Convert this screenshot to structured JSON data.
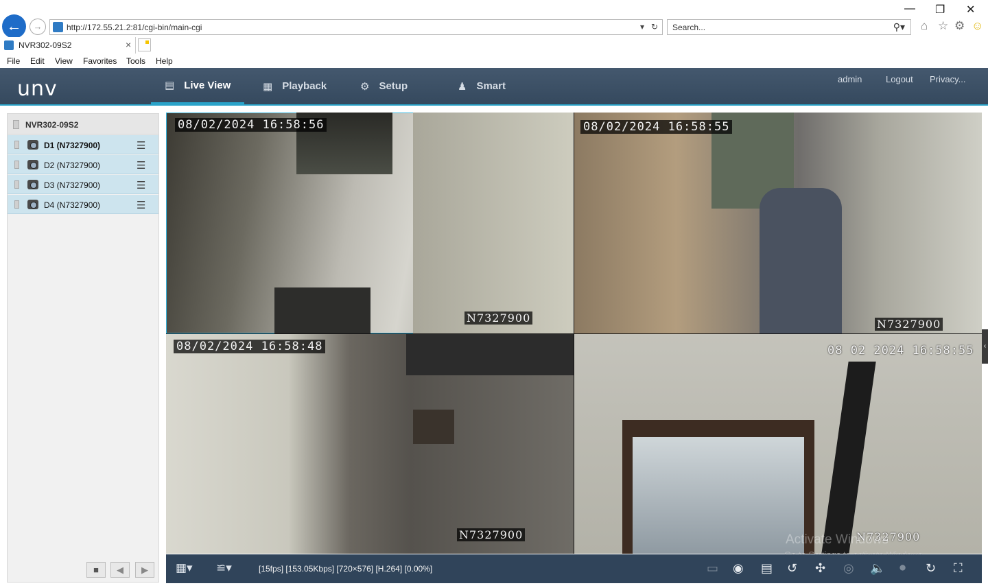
{
  "browser": {
    "url": "http://172.55.21.2:81/cgi-bin/main-cgi",
    "search_placeholder": "Search...",
    "tab_title": "NVR302-09S2",
    "menu": [
      "File",
      "Edit",
      "View",
      "Favorites",
      "Tools",
      "Help"
    ]
  },
  "app": {
    "logo": "unv",
    "nav": [
      "Live View",
      "Playback",
      "Setup",
      "Smart"
    ],
    "user": {
      "name": "admin",
      "logout": "Logout",
      "privacy": "Privacy..."
    }
  },
  "left_panel": {
    "nvr_name": "NVR302-09S2",
    "devices": [
      "D1 (N7327900)",
      "D2 (N7327900)",
      "D3 (N7327900)",
      "D4 (N7327900)"
    ]
  },
  "video": {
    "tiles": [
      {
        "timestamp": "08/02/2024 16:58:56",
        "camera_id": "N7327900"
      },
      {
        "timestamp": "08/02/2024 16:58:55",
        "camera_id": "N7327900"
      },
      {
        "timestamp": "08/02/2024 16:58:48",
        "camera_id": "N7327900"
      },
      {
        "timestamp": "08 02 2024 16:58:55",
        "camera_id": "N7327900"
      }
    ]
  },
  "toolbar": {
    "stream_info": "[15fps] [153.05Kbps] [720×576] [H.264] [0.00%]"
  },
  "watermark": {
    "line1": "Activate Windows",
    "line2": "Go to Settings to activate Windows."
  },
  "colors": {
    "accent": "#2aa3c9",
    "header": "#3b4f64",
    "selected_row": "#cde4ee"
  }
}
